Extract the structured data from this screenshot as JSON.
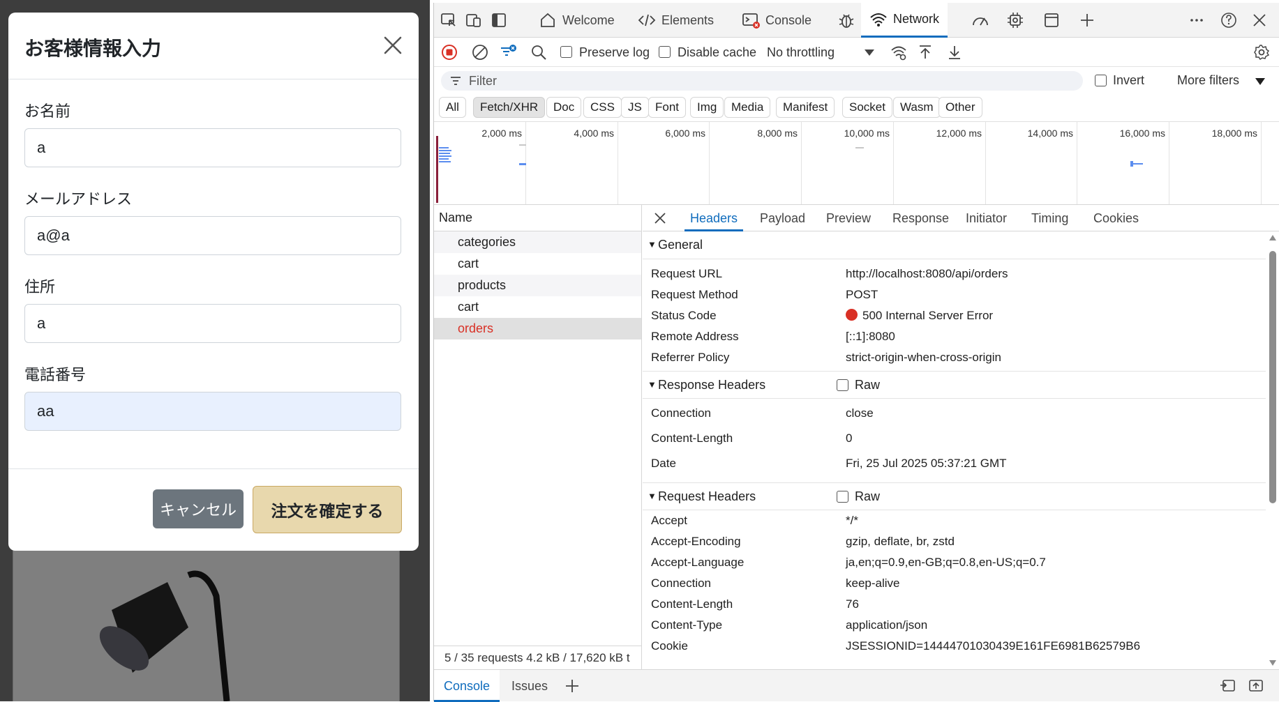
{
  "modal": {
    "title": "お客様情報入力",
    "fields": [
      {
        "label": "お名前",
        "value": "a"
      },
      {
        "label": "メールアドレス",
        "value": "a@a"
      },
      {
        "label": "住所",
        "value": "a"
      },
      {
        "label": "電話番号",
        "value": "aa"
      }
    ],
    "cancel_label": "キャンセル",
    "confirm_label": "注文を確定する"
  },
  "devtools": {
    "tabs": {
      "welcome": "Welcome",
      "elements": "Elements",
      "console": "Console",
      "network": "Network"
    },
    "toolbar": {
      "preserve_log": "Preserve log",
      "disable_cache": "Disable cache",
      "throttling": "No throttling"
    },
    "filter": {
      "placeholder": "Filter",
      "invert": "Invert",
      "more_filters": "More filters"
    },
    "types": [
      "All",
      "Fetch/XHR",
      "Doc",
      "CSS",
      "JS",
      "Font",
      "Img",
      "Media",
      "Manifest",
      "Socket",
      "Wasm",
      "Other"
    ],
    "active_type": "Fetch/XHR",
    "timeline_labels": [
      "2,000 ms",
      "4,000 ms",
      "6,000 ms",
      "8,000 ms",
      "10,000 ms",
      "12,000 ms",
      "14,000 ms",
      "16,000 ms",
      "18,000 ms"
    ],
    "requests": {
      "header": "Name",
      "items": [
        "categories",
        "cart",
        "products",
        "cart",
        "orders"
      ],
      "selected": "orders",
      "summary": "5 / 35 requests   4.2 kB / 17,620 kB t"
    },
    "details": {
      "tabs": [
        "Headers",
        "Payload",
        "Preview",
        "Response",
        "Initiator",
        "Timing",
        "Cookies"
      ],
      "active_tab": "Headers",
      "general": {
        "title": "General",
        "rows": [
          {
            "k": "Request URL",
            "v": "http://localhost:8080/api/orders"
          },
          {
            "k": "Request Method",
            "v": "POST"
          },
          {
            "k": "Status Code",
            "v": "500 Internal Server Error"
          },
          {
            "k": "Remote Address",
            "v": "[::1]:8080"
          },
          {
            "k": "Referrer Policy",
            "v": "strict-origin-when-cross-origin"
          }
        ]
      },
      "response_headers": {
        "title": "Response Headers",
        "raw": "Raw",
        "rows": [
          {
            "k": "Connection",
            "v": "close"
          },
          {
            "k": "Content-Length",
            "v": "0"
          },
          {
            "k": "Date",
            "v": "Fri, 25 Jul 2025 05:37:21 GMT"
          }
        ]
      },
      "request_headers": {
        "title": "Request Headers",
        "raw": "Raw",
        "rows": [
          {
            "k": "Accept",
            "v": "*/*"
          },
          {
            "k": "Accept-Encoding",
            "v": "gzip, deflate, br, zstd"
          },
          {
            "k": "Accept-Language",
            "v": "ja,en;q=0.9,en-GB;q=0.8,en-US;q=0.7"
          },
          {
            "k": "Connection",
            "v": "keep-alive"
          },
          {
            "k": "Content-Length",
            "v": "76"
          },
          {
            "k": "Content-Type",
            "v": "application/json"
          },
          {
            "k": "Cookie",
            "v": "JSESSIONID=14444701030439E161FE6981B62579B6"
          }
        ]
      }
    },
    "drawer": {
      "console": "Console",
      "issues": "Issues"
    },
    "colors": {
      "accent": "#0f6cbd",
      "error": "#d93025"
    }
  }
}
